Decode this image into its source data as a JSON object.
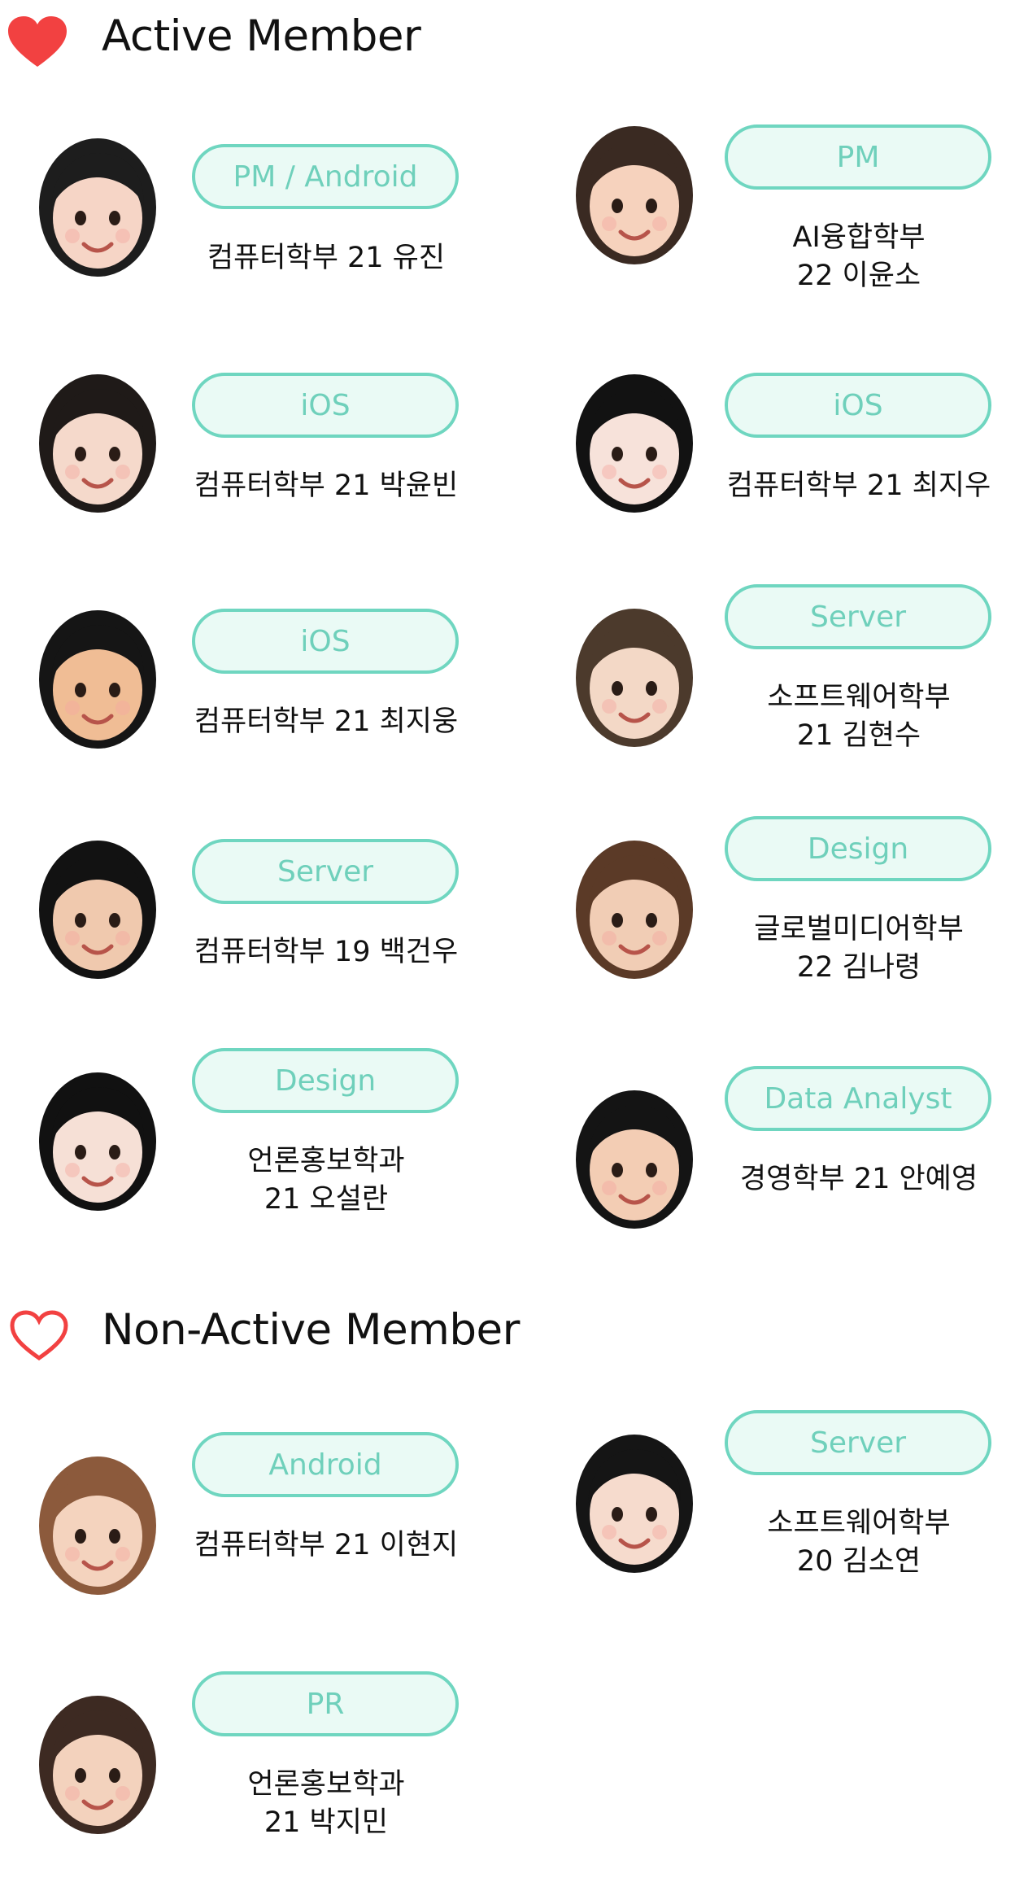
{
  "sections": {
    "active": {
      "title": "Active Member",
      "heart": "heart-filled-icon",
      "color": "#f24141"
    },
    "nonactive": {
      "title": "Non-Active Member",
      "heart": "heart-outline-icon",
      "color": "#f24141"
    }
  },
  "accent": "#6fd6c0",
  "members": [
    {
      "role": "PM / Android",
      "line1": "컴퓨터학부 21 유진",
      "line2": "",
      "avatar": {
        "hair": "#1d1d1d",
        "skin": "#f6d5c6"
      }
    },
    {
      "role": "PM",
      "line1": "AI융합학부",
      "line2": "22 이윤소",
      "avatar": {
        "hair": "#3a2a22",
        "skin": "#f6d2bd"
      }
    },
    {
      "role": "iOS",
      "line1": "컴퓨터학부 21 박윤빈",
      "line2": "",
      "avatar": {
        "hair": "#1f1a18",
        "skin": "#f5d9cb"
      }
    },
    {
      "role": "iOS",
      "line1": "컴퓨터학부 21 최지우",
      "line2": "",
      "avatar": {
        "hair": "#121212",
        "skin": "#f7e2da"
      }
    },
    {
      "role": "iOS",
      "line1": "컴퓨터학부 21 최지웅",
      "line2": "",
      "avatar": {
        "hair": "#151515",
        "skin": "#f0bd95"
      }
    },
    {
      "role": "Server",
      "line1": "소프트웨어학부",
      "line2": "21 김현수",
      "avatar": {
        "hair": "#4c3a2c",
        "skin": "#f3d8c6"
      }
    },
    {
      "role": "Server",
      "line1": "컴퓨터학부 19 백건우",
      "line2": "",
      "avatar": {
        "hair": "#121212",
        "skin": "#f0c9ae"
      }
    },
    {
      "role": "Design",
      "line1": "글로벌미디어학부",
      "line2": "22 김나령",
      "avatar": {
        "hair": "#5b3a27",
        "skin": "#f1cdb5"
      }
    },
    {
      "role": "Design",
      "line1": "언론홍보학과",
      "line2": "21 오설란",
      "avatar": {
        "hair": "#111111",
        "skin": "#f6e0d6"
      }
    },
    {
      "role": "Data Analyst",
      "line1": "경영학부 21 안예영",
      "line2": "",
      "avatar": {
        "hair": "#141414",
        "skin": "#f3cdb4"
      }
    },
    {
      "role": "Android",
      "line1": "컴퓨터학부 21 이현지",
      "line2": "",
      "avatar": {
        "hair": "#8c5a3c",
        "skin": "#f4d3be"
      }
    },
    {
      "role": "Server",
      "line1": "소프트웨어학부",
      "line2": "20 김소연",
      "avatar": {
        "hair": "#151515",
        "skin": "#f6dbcd"
      }
    },
    {
      "role": "PR",
      "line1": "언론홍보학과",
      "line2": "21 박지민",
      "avatar": {
        "hair": "#3d2a22",
        "skin": "#f3d2bd"
      }
    }
  ]
}
